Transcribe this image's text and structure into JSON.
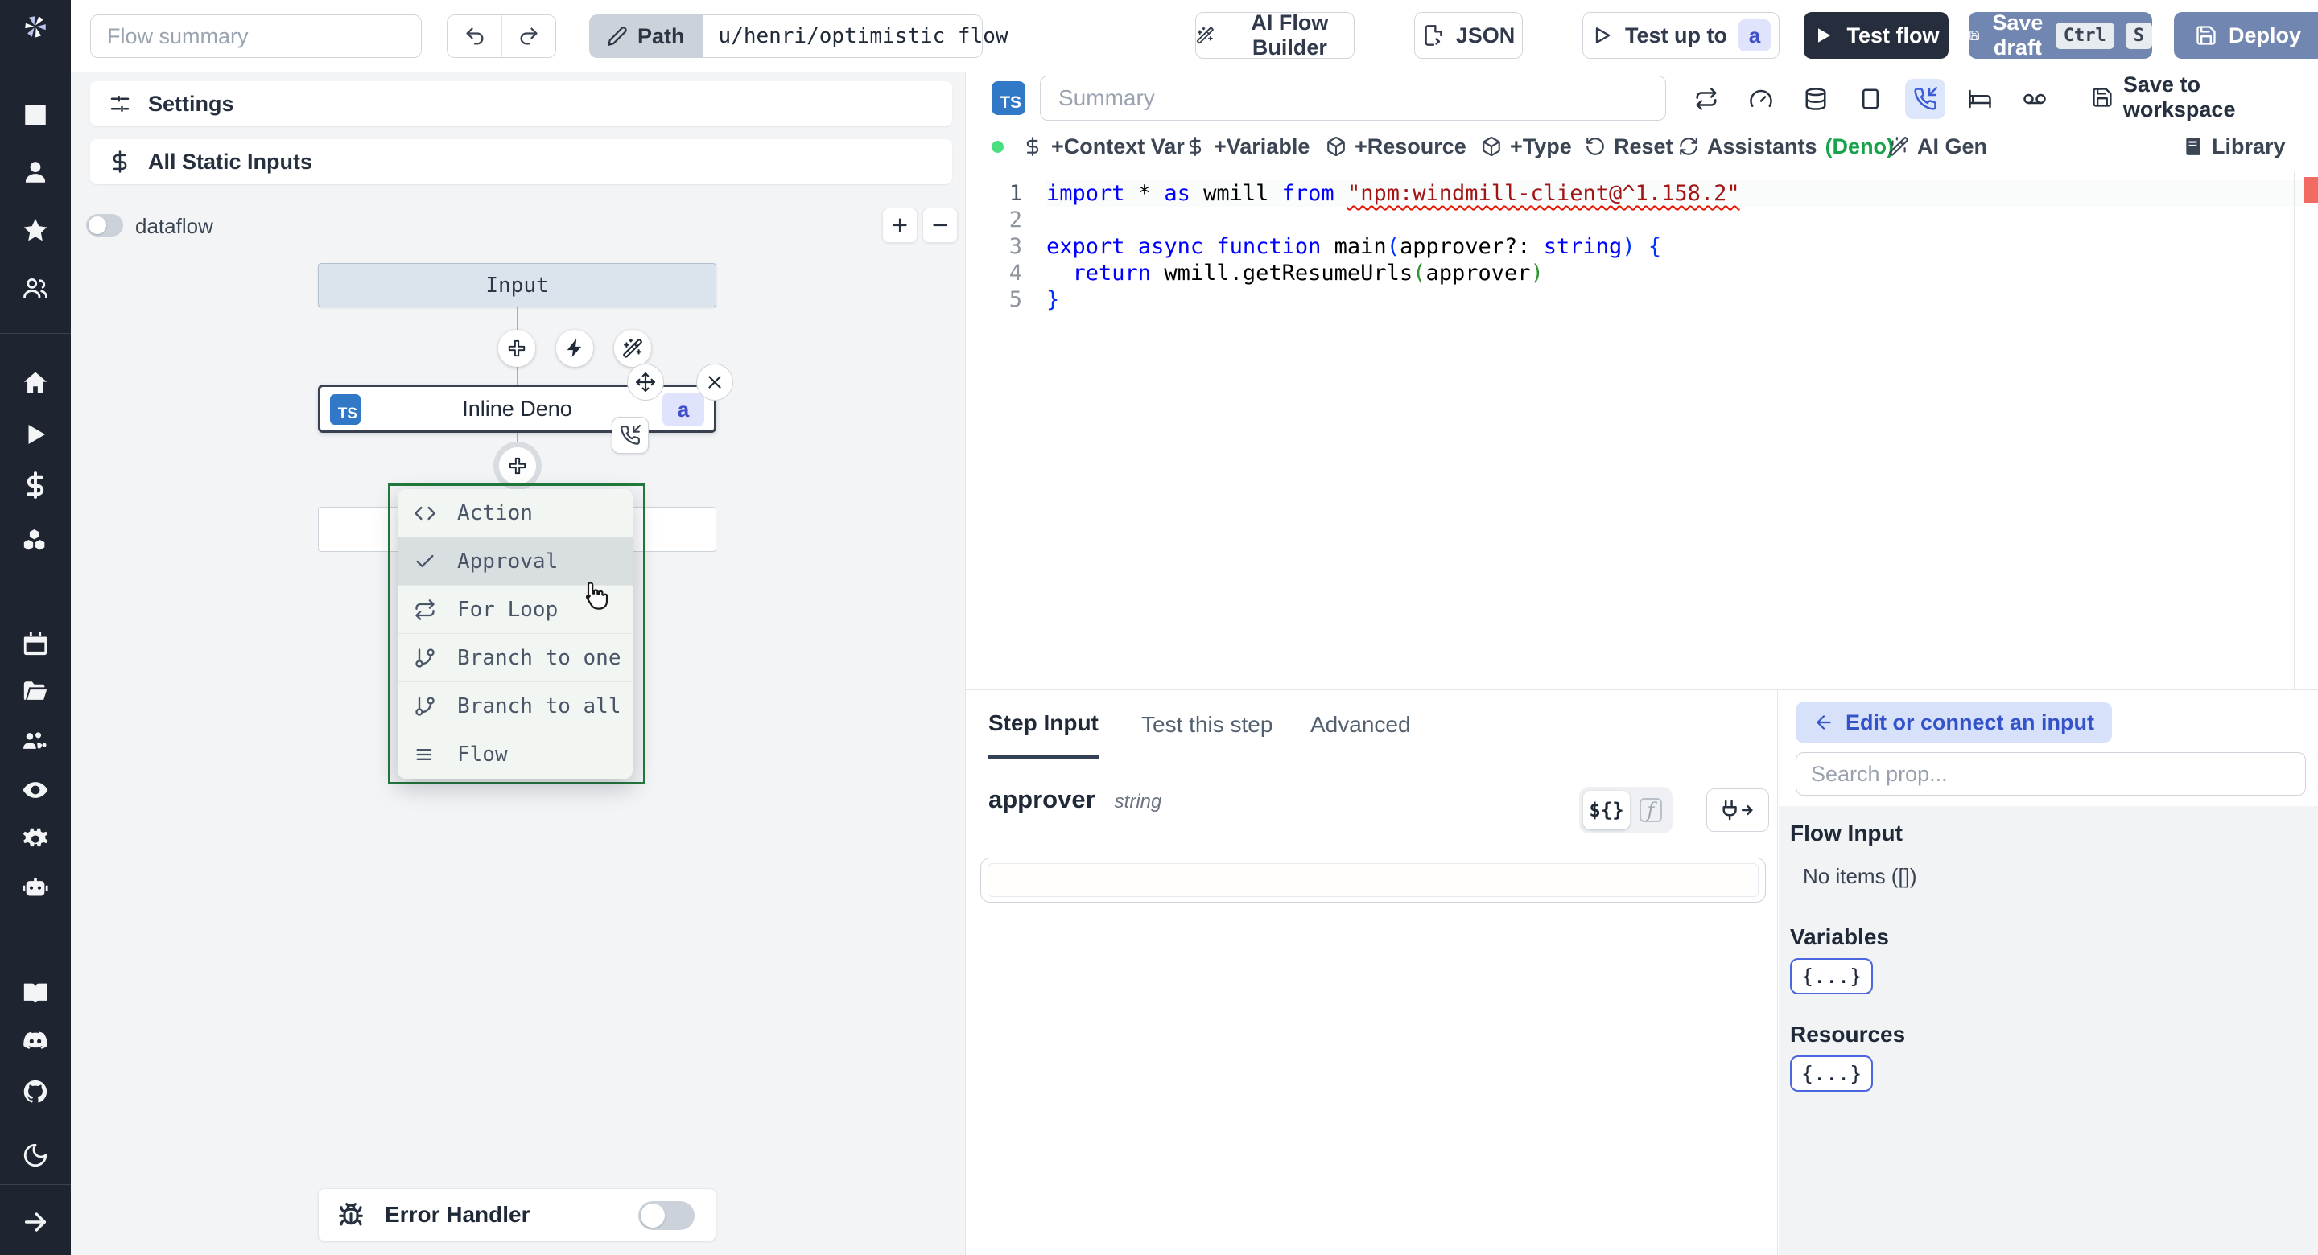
{
  "topbar": {
    "flow_summary_placeholder": "Flow summary",
    "path_label": "Path",
    "path_value": "u/henri/optimistic_flow",
    "ai_flow_builder": "AI Flow Builder",
    "json_label": "JSON",
    "test_up_to": "Test up to",
    "test_up_to_badge": "a",
    "test_flow": "Test flow",
    "save_draft": "Save draft",
    "kbd_ctrl": "Ctrl",
    "kbd_s": "S",
    "deploy": "Deploy"
  },
  "sidebar": {
    "icons": [
      "windmill-logo",
      "building",
      "user",
      "star",
      "users",
      "home",
      "play",
      "dollar",
      "boxes",
      "calendar",
      "folder-open",
      "users-gear",
      "eye",
      "gear",
      "bot",
      "book",
      "discord",
      "github",
      "moon",
      "arrow-right"
    ]
  },
  "left_panel": {
    "settings": "Settings",
    "all_static_inputs": "All Static Inputs",
    "dataflow": "dataflow",
    "input_node": "Input",
    "step_node": "Inline Deno",
    "step_node_lang": "TS",
    "step_badge": "a",
    "menu": {
      "items": [
        {
          "icon": "code",
          "label": "Action"
        },
        {
          "icon": "check",
          "label": "Approval"
        },
        {
          "icon": "repeat",
          "label": "For Loop"
        },
        {
          "icon": "git-branch",
          "label": "Branch to one"
        },
        {
          "icon": "git-branch",
          "label": "Branch to all"
        },
        {
          "icon": "list",
          "label": "Flow"
        }
      ],
      "selected": "Approval"
    },
    "error_handler": "Error Handler"
  },
  "editor": {
    "lang_badge": "TS",
    "summary_placeholder": "Summary",
    "save_to_workspace": "Save to workspace",
    "toolbar_icons": [
      "retries",
      "early-stop",
      "cache",
      "mock",
      "suspend",
      "sleep",
      "early-return"
    ],
    "actions": {
      "context_var": "+Context Var",
      "variable": "+Variable",
      "resource": "+Resource",
      "type": "+Type",
      "reset": "Reset",
      "assistants": "Assistants",
      "assistants_lang": "(Deno)",
      "ai_gen": "AI Gen",
      "library": "Library"
    },
    "code": {
      "line_numbers": [
        "1",
        "2",
        "3",
        "4",
        "5"
      ],
      "lines": [
        [
          [
            "kw",
            "import"
          ],
          [
            "pl",
            " * "
          ],
          [
            "kw",
            "as"
          ],
          [
            "pl",
            " wmill "
          ],
          [
            "kw",
            "from"
          ],
          [
            "pl",
            " "
          ],
          [
            "str",
            "\"npm:windmill-client@^1.158.2\""
          ]
        ],
        [],
        [
          [
            "kw",
            "export"
          ],
          [
            "pl",
            " "
          ],
          [
            "kw",
            "async"
          ],
          [
            "pl",
            " "
          ],
          [
            "kw",
            "function"
          ],
          [
            "pl",
            " main"
          ],
          [
            "b1",
            "("
          ],
          [
            "pl",
            "approver?: "
          ],
          [
            "kw",
            "string"
          ],
          [
            "b1",
            ")"
          ],
          [
            "pl",
            " "
          ],
          [
            "b1",
            "{"
          ]
        ],
        [
          [
            "pl",
            "  "
          ],
          [
            "kw",
            "return"
          ],
          [
            "pl",
            " wmill.getResumeUrls"
          ],
          [
            "b2",
            "("
          ],
          [
            "pl",
            "approver"
          ],
          [
            "b2",
            ")"
          ]
        ],
        [
          [
            "b1",
            "}"
          ]
        ]
      ]
    }
  },
  "step_panel": {
    "tabs": [
      "Step Input",
      "Test this step",
      "Advanced"
    ],
    "active_tab": "Step Input",
    "field_name": "approver",
    "field_type": "string",
    "expr_toggle": "${}",
    "fn_toggle": "f",
    "props": {
      "edit_connect": "Edit or connect an input",
      "search_placeholder": "Search prop...",
      "flow_input": "Flow Input",
      "no_items": "No items ([])",
      "variables": "Variables",
      "resources": "Resources",
      "braces": "{...}"
    }
  },
  "colors": {
    "sidebar_bg": "#1f2530",
    "canvas_bg": "#f2f4f6",
    "primary_button": "#7187b1",
    "dark_button": "#262e3d",
    "ts_blue": "#3178c6",
    "badge_bg": "#dfe3fc",
    "badge_text": "#4050c8",
    "menu_selection_border": "#237a3c",
    "deno_green": "#16a34a",
    "status_dot": "#4ade80",
    "error_marker": "#f16b63"
  }
}
